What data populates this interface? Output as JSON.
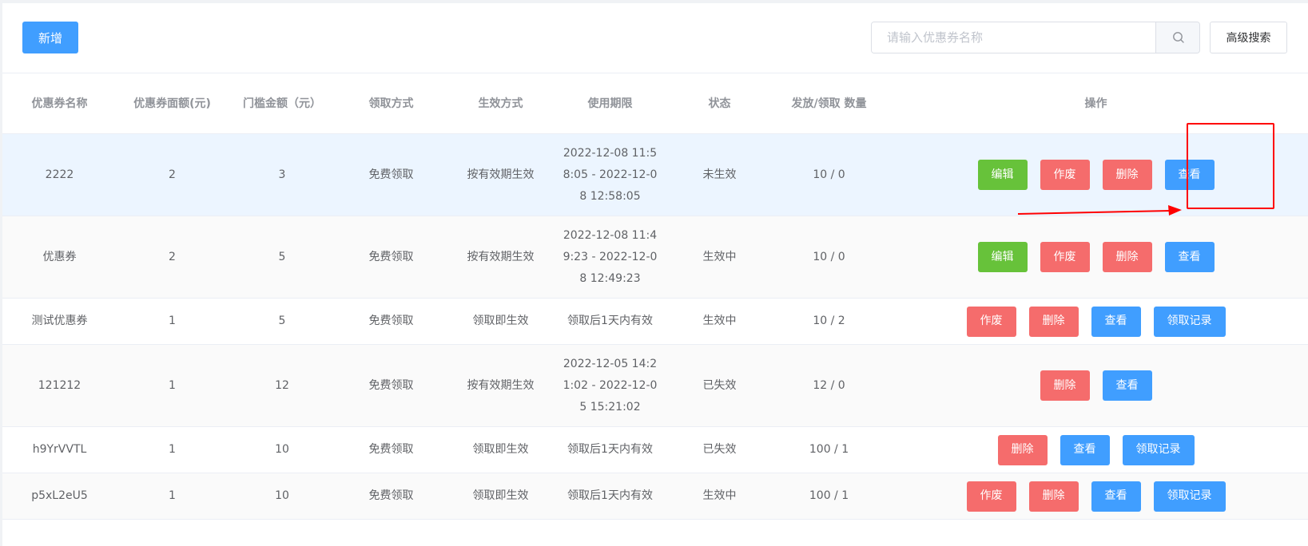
{
  "toolbar": {
    "add_label": "新增",
    "search_placeholder": "请输入优惠券名称",
    "search_value": "",
    "search_icon": "search-icon",
    "advanced_label": "高级搜索"
  },
  "table": {
    "columns": [
      "优惠券名称",
      "优惠券面额(元)",
      "门槛金额（元）",
      "领取方式",
      "生效方式",
      "使用期限",
      "状态",
      "发放/领取 数量",
      "操作"
    ],
    "rows": [
      {
        "name": "2222",
        "amount": "2",
        "threshold": "3",
        "claim": "免费领取",
        "effect": "按有效期生效",
        "period": "2022-12-08 11:58:05 - 2022-12-08 12:58:05",
        "status": "未生效",
        "count": "10 / 0",
        "actions": [
          "编辑",
          "作废",
          "删除",
          "查看"
        ]
      },
      {
        "name": "优惠券",
        "amount": "2",
        "threshold": "5",
        "claim": "免费领取",
        "effect": "按有效期生效",
        "period": "2022-12-08 11:49:23 - 2022-12-08 12:49:23",
        "status": "生效中",
        "count": "10 / 0",
        "actions": [
          "编辑",
          "作废",
          "删除",
          "查看"
        ]
      },
      {
        "name": "测试优惠券",
        "amount": "1",
        "threshold": "5",
        "claim": "免费领取",
        "effect": "领取即生效",
        "period": "领取后1天内有效",
        "status": "生效中",
        "count": "10 / 2",
        "actions": [
          "作废",
          "删除",
          "查看",
          "领取记录"
        ]
      },
      {
        "name": "121212",
        "amount": "1",
        "threshold": "12",
        "claim": "免费领取",
        "effect": "按有效期生效",
        "period": "2022-12-05 14:21:02 - 2022-12-05 15:21:02",
        "status": "已失效",
        "count": "12 / 0",
        "actions": [
          "删除",
          "查看"
        ]
      },
      {
        "name": "h9YrVVTL",
        "amount": "1",
        "threshold": "10",
        "claim": "免费领取",
        "effect": "领取即生效",
        "period": "领取后1天内有效",
        "status": "已失效",
        "count": "100 / 1",
        "actions": [
          "删除",
          "查看",
          "领取记录"
        ]
      },
      {
        "name": "p5xL2eU5",
        "amount": "1",
        "threshold": "10",
        "claim": "免费领取",
        "effect": "领取即生效",
        "period": "领取后1天内有效",
        "status": "生效中",
        "count": "100 / 1",
        "actions": [
          "作废",
          "删除",
          "查看",
          "领取记录"
        ]
      }
    ]
  },
  "annotation": {
    "highlight_color": "#ff0000"
  },
  "colors": {
    "primary": "#409eff",
    "success": "#67c23a",
    "danger": "#f56c6c",
    "row_hover": "#ecf5ff"
  }
}
